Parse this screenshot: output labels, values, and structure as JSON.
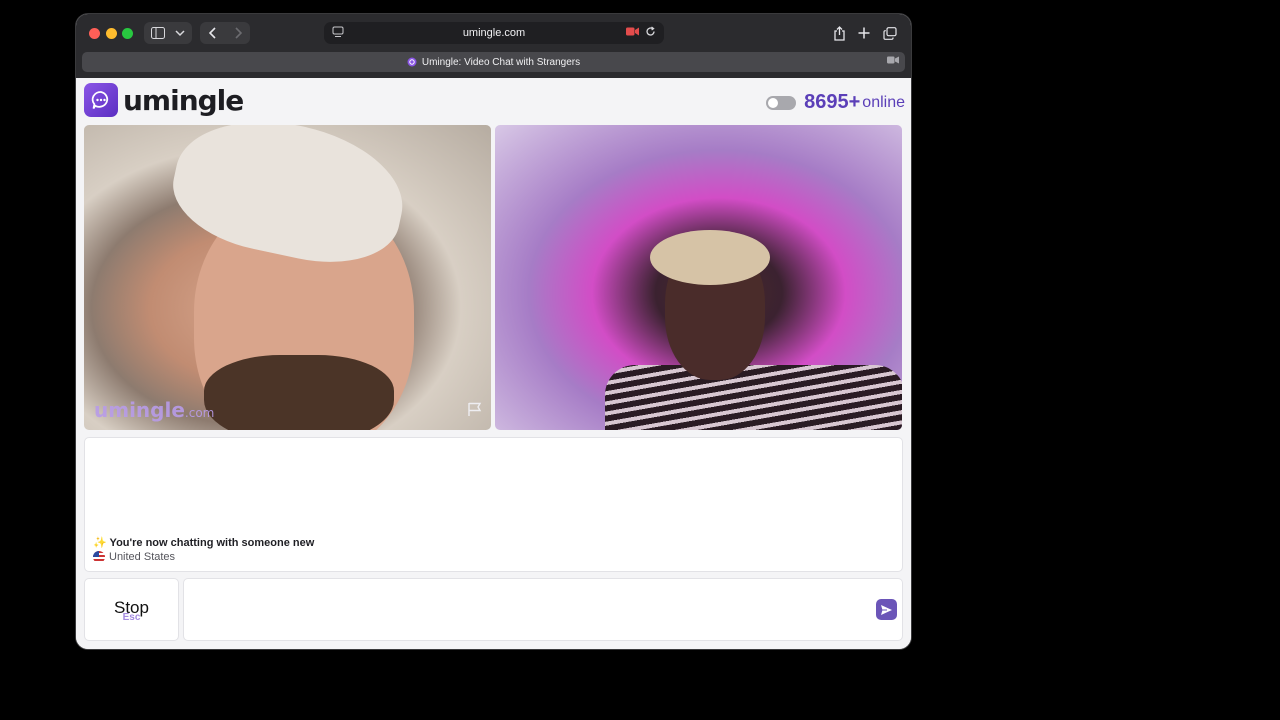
{
  "browser": {
    "url": "umingle.com",
    "tab_title": "Umingle: Video Chat with Strangers"
  },
  "header": {
    "logo_text": "umingle",
    "online_count": "8695+",
    "online_label": "online"
  },
  "videos": {
    "left_watermark": "umingle",
    "left_watermark_suffix": ".com"
  },
  "chat": {
    "status_message": "✨ You're now chatting with someone new",
    "country": "United States"
  },
  "controls": {
    "stop_label": "Stop",
    "stop_hint": "Esc",
    "message_placeholder": ""
  },
  "colors": {
    "brand": "#5b3fb8",
    "accent": "#a48be0"
  }
}
